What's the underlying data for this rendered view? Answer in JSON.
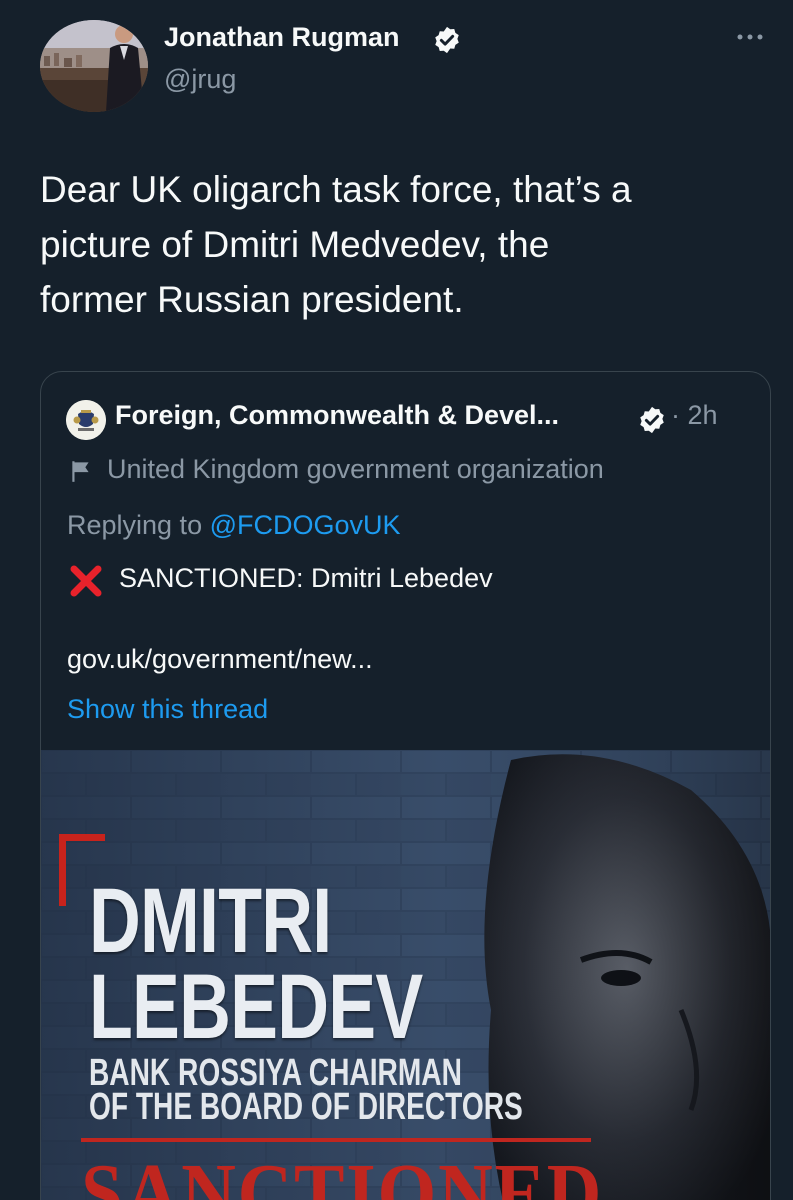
{
  "tweet": {
    "author_name": "Jonathan Rugman",
    "handle": "@jrug",
    "text_lines": [
      "Dear UK oligarch task force, that’s a",
      "picture of Dmitri Medvedev, the",
      "former Russian president."
    ],
    "avatar_icon": "profile-photo",
    "verified_icon": "verified-badge-icon",
    "more_icon": "more-options-icon"
  },
  "quote": {
    "author_name": "Foreign, Commonwealth & Devel...",
    "time": "· 2h",
    "org_label": "United Kingdom government organization",
    "replying_prefix": "Replying to ",
    "replying_mention": "@FCDOGovUK",
    "sanction_text": "SANCTIONED: Dmitri Lebedev",
    "link_text": "gov.uk/government/new...",
    "show_thread": "Show this thread",
    "badge_icon": "affiliate-badge-icon",
    "org_icon": "flag-icon",
    "x_icon": "cross-mark-icon"
  },
  "media": {
    "title_line1": "DMITRI",
    "title_line2": "LEBEDEV",
    "subtitle_line1": "BANK ROSSIYA CHAIRMAN",
    "subtitle_line2": "OF THE BOARD OF DIRECTORS",
    "stamp": "SANCTIONED"
  },
  "colors": {
    "background": "#15202b",
    "text": "#f7f9f9",
    "secondary": "#8b98a5",
    "link": "#1d9bf0",
    "border": "#38444d",
    "accent_red": "#c0261f"
  }
}
